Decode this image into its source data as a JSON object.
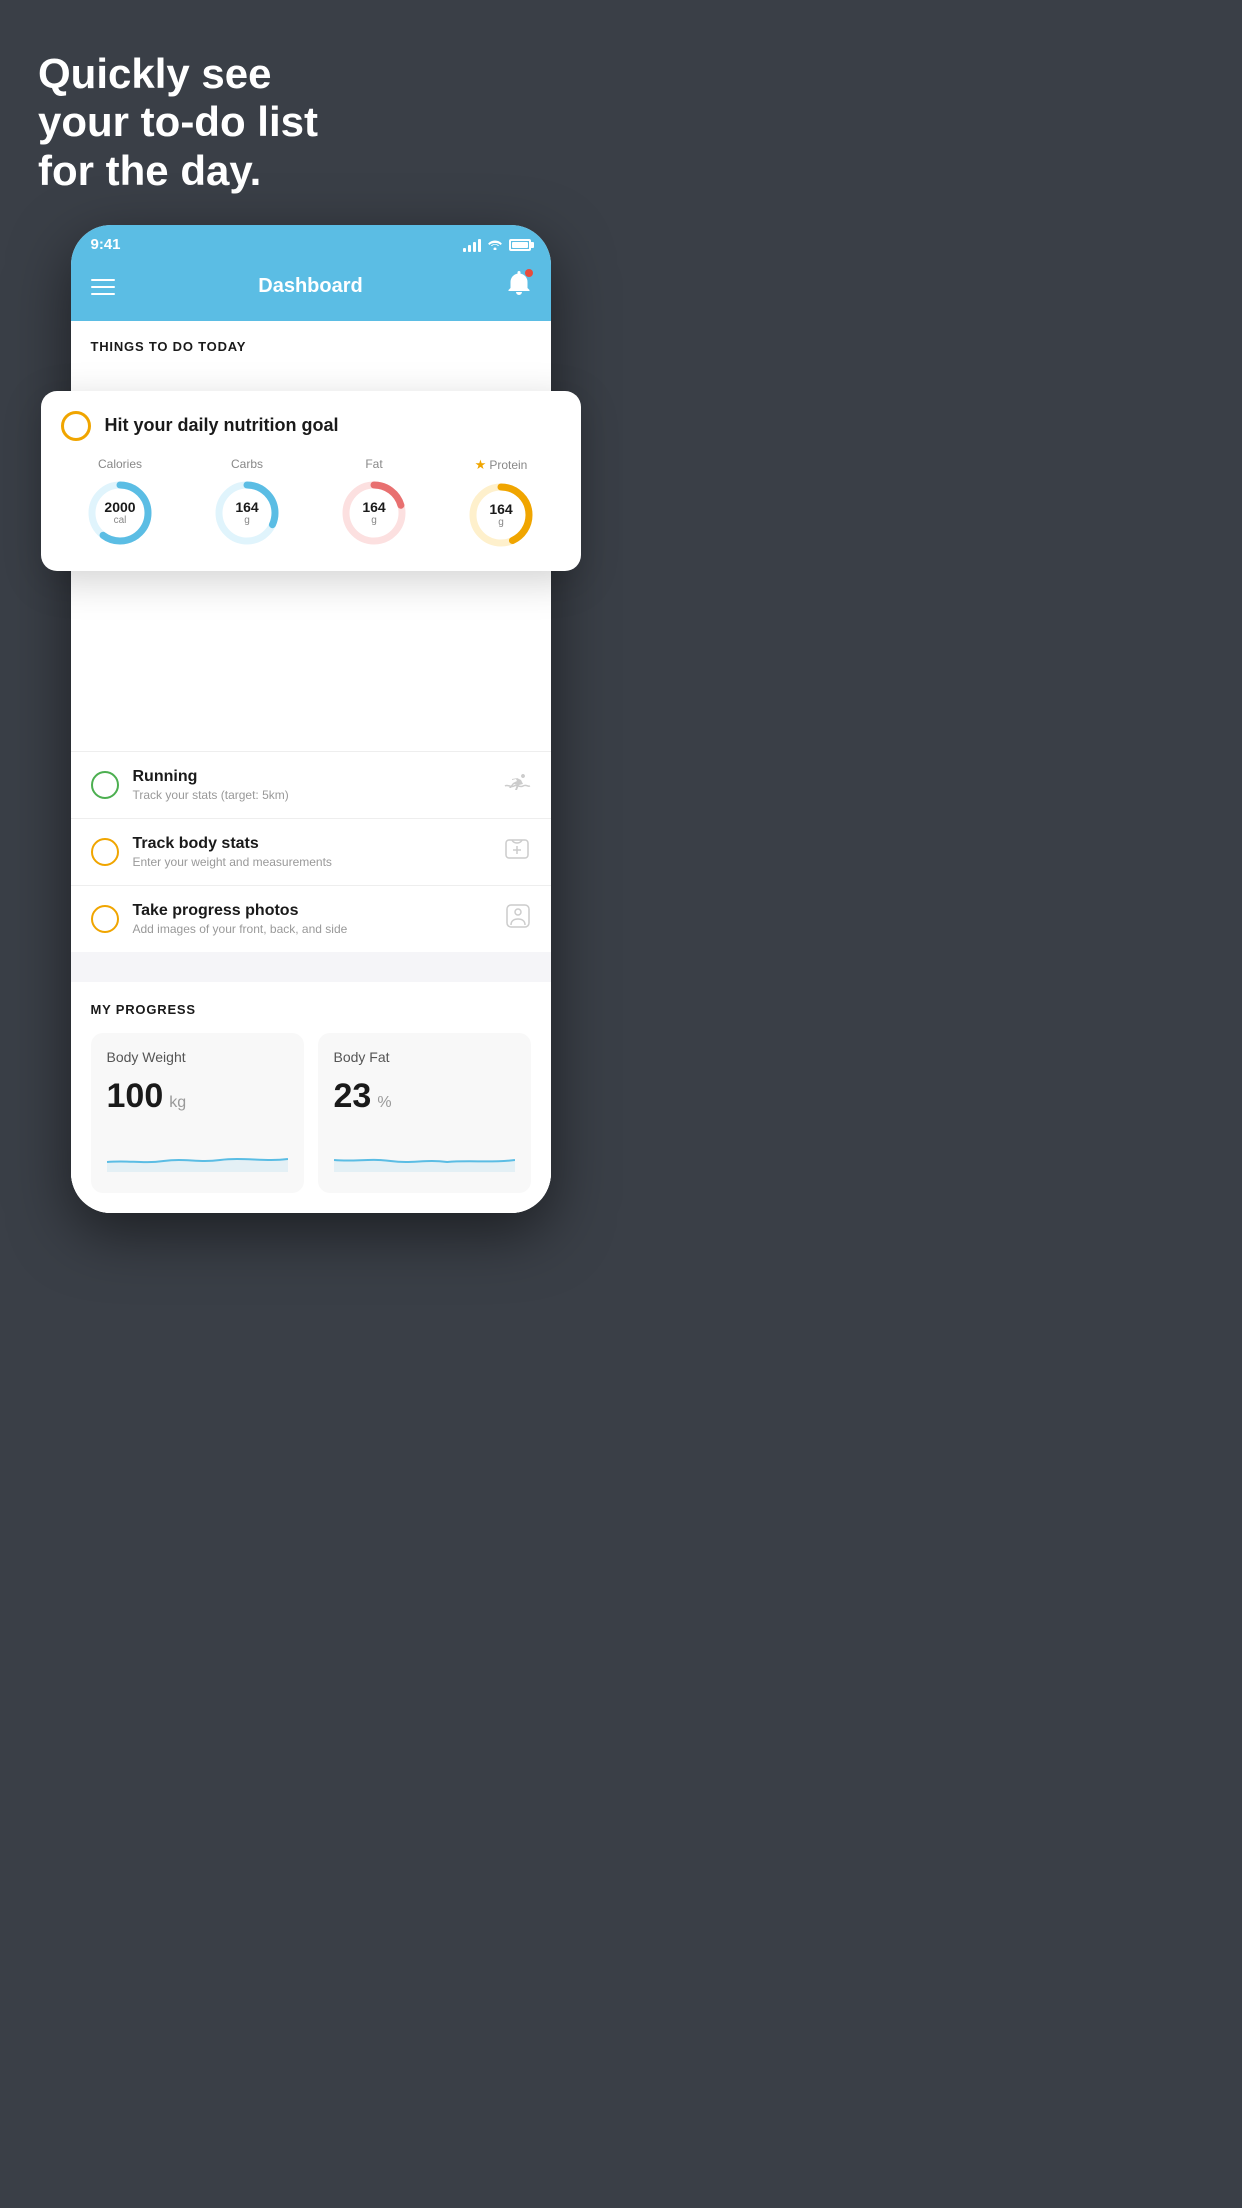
{
  "hero": {
    "title": "Quickly see\nyour to-do list\nfor the day."
  },
  "phone": {
    "statusBar": {
      "time": "9:41"
    },
    "header": {
      "title": "Dashboard"
    },
    "thingsToDo": {
      "sectionLabel": "THINGS TO DO TODAY"
    },
    "nutritionCard": {
      "title": "Hit your daily nutrition goal",
      "items": [
        {
          "label": "Calories",
          "value": "2000",
          "unit": "cal",
          "color": "#5bbde4",
          "trackColor": "#e0f4fc"
        },
        {
          "label": "Carbs",
          "value": "164",
          "unit": "g",
          "color": "#5bbde4",
          "trackColor": "#e0f4fc"
        },
        {
          "label": "Fat",
          "value": "164",
          "unit": "g",
          "color": "#e87070",
          "trackColor": "#fce0e0"
        },
        {
          "label": "Protein",
          "value": "164",
          "unit": "g",
          "color": "#f0a500",
          "trackColor": "#fef0cc",
          "star": true
        }
      ]
    },
    "todoItems": [
      {
        "title": "Running",
        "subtitle": "Track your stats (target: 5km)",
        "circleColor": "green",
        "icon": "🏃"
      },
      {
        "title": "Track body stats",
        "subtitle": "Enter your weight and measurements",
        "circleColor": "yellow",
        "icon": "⚖"
      },
      {
        "title": "Take progress photos",
        "subtitle": "Add images of your front, back, and side",
        "circleColor": "yellow",
        "icon": "👤"
      }
    ],
    "progress": {
      "sectionLabel": "MY PROGRESS",
      "cards": [
        {
          "title": "Body Weight",
          "value": "100",
          "unit": "kg"
        },
        {
          "title": "Body Fat",
          "value": "23",
          "unit": "%"
        }
      ]
    }
  }
}
